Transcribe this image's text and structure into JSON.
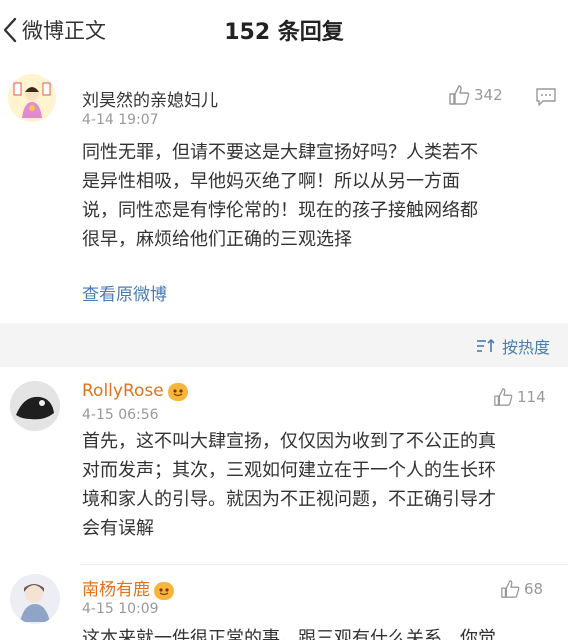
{
  "nav": {
    "back_label": "微博正文",
    "title": "152 条回复"
  },
  "main_comment": {
    "username": "刘昊然的亲媳妇儿",
    "timestamp": "4-14 19:07",
    "like_count": "342",
    "text_lines": [
      "同性无罪，但请不要这是大肆宣扬好吗？人类若不",
      "是异性相吸，早他妈灭绝了啊！所以从另一方面",
      "说，同性恋是有悖伦常的！现在的孩子接触网络都",
      "很早，麻烦给他们正确的三观选择"
    ],
    "view_original": "查看原微博"
  },
  "sort": {
    "label": "按热度"
  },
  "replies": [
    {
      "username": "RollyRose",
      "timestamp": "4-15 06:56",
      "like_count": "114",
      "text_lines": [
        "首先，这不叫大肆宣扬，仅仅因为收到了不公正的真",
        "对而发声；其次，三观如何建立在于一个人的生长环",
        "境和家人的引导。就因为不正视问题，不正确引导才",
        "会有误解"
      ]
    },
    {
      "username": "南杨有鹿",
      "timestamp": "4-15 10:09",
      "like_count": "68",
      "text_lines": [
        "这本来就一件很正常的事，跟三观有什么关系，你觉"
      ]
    }
  ],
  "colors": {
    "link_blue": "#4a7bb2",
    "username_orange": "#e0731c",
    "gray_text": "#999999",
    "band_gray": "#f4f4f4"
  },
  "icons": {
    "back": "chevron-left-icon",
    "like": "thumbs-up-icon",
    "comment": "comment-icon",
    "sort": "sort-icon",
    "badge": "vip-badge-icon"
  }
}
